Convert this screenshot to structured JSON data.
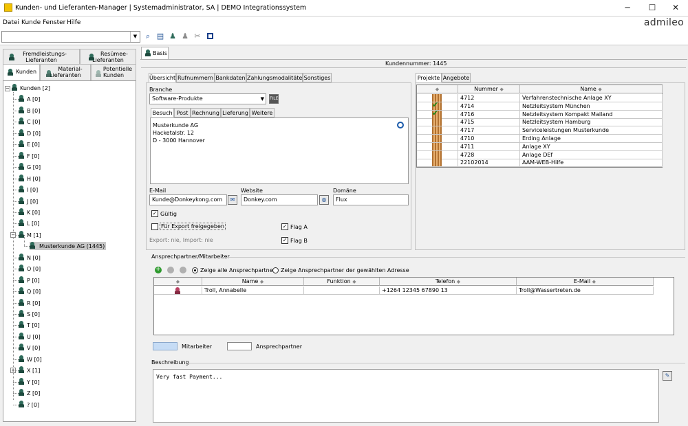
{
  "window": {
    "title": "Kunden- und Lieferanten-Manager | Systemadministrator, SA | DEMO Integrationssystem",
    "minimize": "─",
    "maximize": "☐",
    "close": "✕"
  },
  "menu": [
    "Datei",
    "Kunde",
    "Fenster",
    "Hilfe"
  ],
  "logo": "admileo",
  "toolbar": {
    "combo_value": "",
    "icons": [
      "search-icon",
      "search-list-icon",
      "people-icon",
      "disabled-people-icon",
      "disabled-tools-icon",
      "stop-icon"
    ]
  },
  "left_tabs": {
    "fremdleistung": "Fremdleistungs-\nLieferanten",
    "resuemee": "Resümee-\nLieferanten",
    "kunden": "Kunden",
    "material": "Material-\nLieferanten",
    "potentielle": "Potentielle\nKunden"
  },
  "tree": {
    "root": "Kunden [2]",
    "nodes": [
      "A [0]",
      "B [0]",
      "C [0]",
      "D [0]",
      "E [0]",
      "F [0]",
      "G [0]",
      "H [0]",
      "I [0]",
      "J [0]",
      "K [0]",
      "L [0]",
      "M [1]",
      "Musterkunde AG (1445)",
      "N [0]",
      "O [0]",
      "P [0]",
      "Q [0]",
      "R [0]",
      "S [0]",
      "T [0]",
      "U [0]",
      "V [0]",
      "W [0]",
      "X [1]",
      "Y [0]",
      "Z [0]",
      "? [0]"
    ]
  },
  "basis_tab": "Basis",
  "kundennummer": "Kundennummer: 1445",
  "detail_tabs": [
    "Übersicht",
    "Rufnummern",
    "Bankdaten",
    "Zahlungsmodalitäten",
    "Sonstiges"
  ],
  "branche": {
    "label": "Branche",
    "value": "Software-Produkte"
  },
  "address_tabs": [
    "Besuch",
    "Post",
    "Rechnung",
    "Lieferung",
    "Weitere"
  ],
  "address": [
    "Musterkunde AG",
    "Hacketalstr. 12",
    "D - 3000 Hannover"
  ],
  "email": {
    "label": "E-Mail",
    "value": "Kunde@Donkeykong.com"
  },
  "website": {
    "label": "Website",
    "value": "Donkey.com"
  },
  "domaene": {
    "label": "Domäne",
    "value": "Flux"
  },
  "gueltig": {
    "label": "Gültig",
    "checked": true
  },
  "export": {
    "label": "Für Export freigegeben",
    "checked": false,
    "info": "Export: nie, Import: nie"
  },
  "flag_a": {
    "label": "Flag A",
    "checked": true
  },
  "flag_b": {
    "label": "Flag B",
    "checked": true
  },
  "project_tabs": [
    "Projekte",
    "Angebote"
  ],
  "projects": {
    "headers": [
      "",
      "Nummer",
      "Name"
    ],
    "rows": [
      {
        "nummer": "4712",
        "name": "Verfahrenstechnische Anlage XY",
        "done": false
      },
      {
        "nummer": "4714",
        "name": "Netzleitsystem München",
        "done": true
      },
      {
        "nummer": "4716",
        "name": "Netzleitsystem Kompakt Mailand",
        "done": true
      },
      {
        "nummer": "4715",
        "name": "Netzleitsystem Hamburg",
        "done": false
      },
      {
        "nummer": "4717",
        "name": "Serviceleistungen Musterkunde",
        "done": false
      },
      {
        "nummer": "4710",
        "name": "Erding Anlage",
        "done": false
      },
      {
        "nummer": "4711",
        "name": "Anlage XY",
        "done": false
      },
      {
        "nummer": "4728",
        "name": "Anlage DEf",
        "done": false
      },
      {
        "nummer": "22102014",
        "name": "AAM-WEB-Hilfe",
        "done": false
      }
    ]
  },
  "contacts_section": {
    "title": "Ansprechpartner/Mitarbeiter",
    "radio_all": "Zeige alle Ansprechpartner",
    "radio_selected": "Zeige Ansprechpartner der gewählten Adresse",
    "headers": [
      "",
      "Name",
      "Funktion",
      "Telefon",
      "E-Mail"
    ],
    "rows": [
      {
        "name": "Troll, Annabelle",
        "funktion": "",
        "telefon": "+1264 12345 67890 13",
        "email": "Troll@Wassertreten.de"
      }
    ],
    "legend_mitarbeiter": "Mitarbeiter",
    "legend_ansprechpartner": "Ansprechpartner",
    "colors": {
      "mitarbeiter": "#c6dcf5",
      "ansprechpartner": "#ffffff"
    }
  },
  "beschreibung": {
    "title": "Beschreibung",
    "text": "Very fast Payment..."
  }
}
